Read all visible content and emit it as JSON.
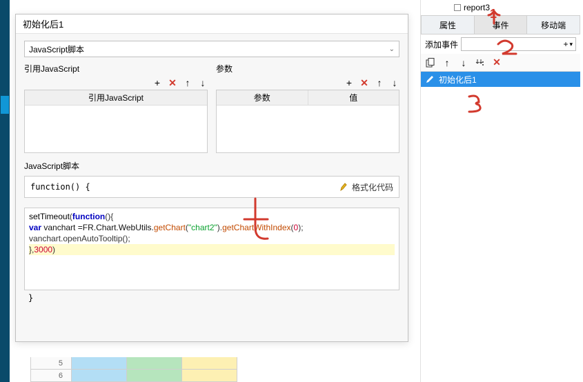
{
  "tree": {
    "item": "report3"
  },
  "right_tabs": {
    "t1": "属性",
    "t2": "事件",
    "t3": "移动端"
  },
  "add_event": {
    "label": "添加事件"
  },
  "event_list": {
    "item": "初始化后1"
  },
  "dialog": {
    "title": "初始化后1",
    "script_type": "JavaScript脚本",
    "left_header": "引用JavaScript",
    "right_header": "参数",
    "left_grid_col": "引用JavaScript",
    "right_grid_col1": "参数",
    "right_grid_col2": "值",
    "script_section": "JavaScript脚本",
    "function_label": "function() {",
    "format_btn": "格式化代码",
    "close_brace": "}"
  },
  "code": {
    "l1_a": "setTimeout",
    "l1_b": "function",
    "l1_c": "(){",
    "l2_a": "var",
    "l2_b": " vanchart =FR.Chart.WebUtils.",
    "l2_c": "getChart",
    "l2_d": "(",
    "l2_e": "\"chart2\"",
    "l2_f": ").",
    "l2_g": "getChartWithIndex",
    "l2_h": "(",
    "l2_i": "0",
    "l2_j": ");",
    "l3": "vanchart.openAutoTooltip();",
    "l4_a": "},",
    "l4_b": "3000",
    "l4_c": ")"
  },
  "sheet": {
    "row1": "5",
    "row2": "6"
  },
  "annotations": {
    "a1": "1",
    "a2": "2",
    "a3": "3",
    "a4": "4"
  }
}
